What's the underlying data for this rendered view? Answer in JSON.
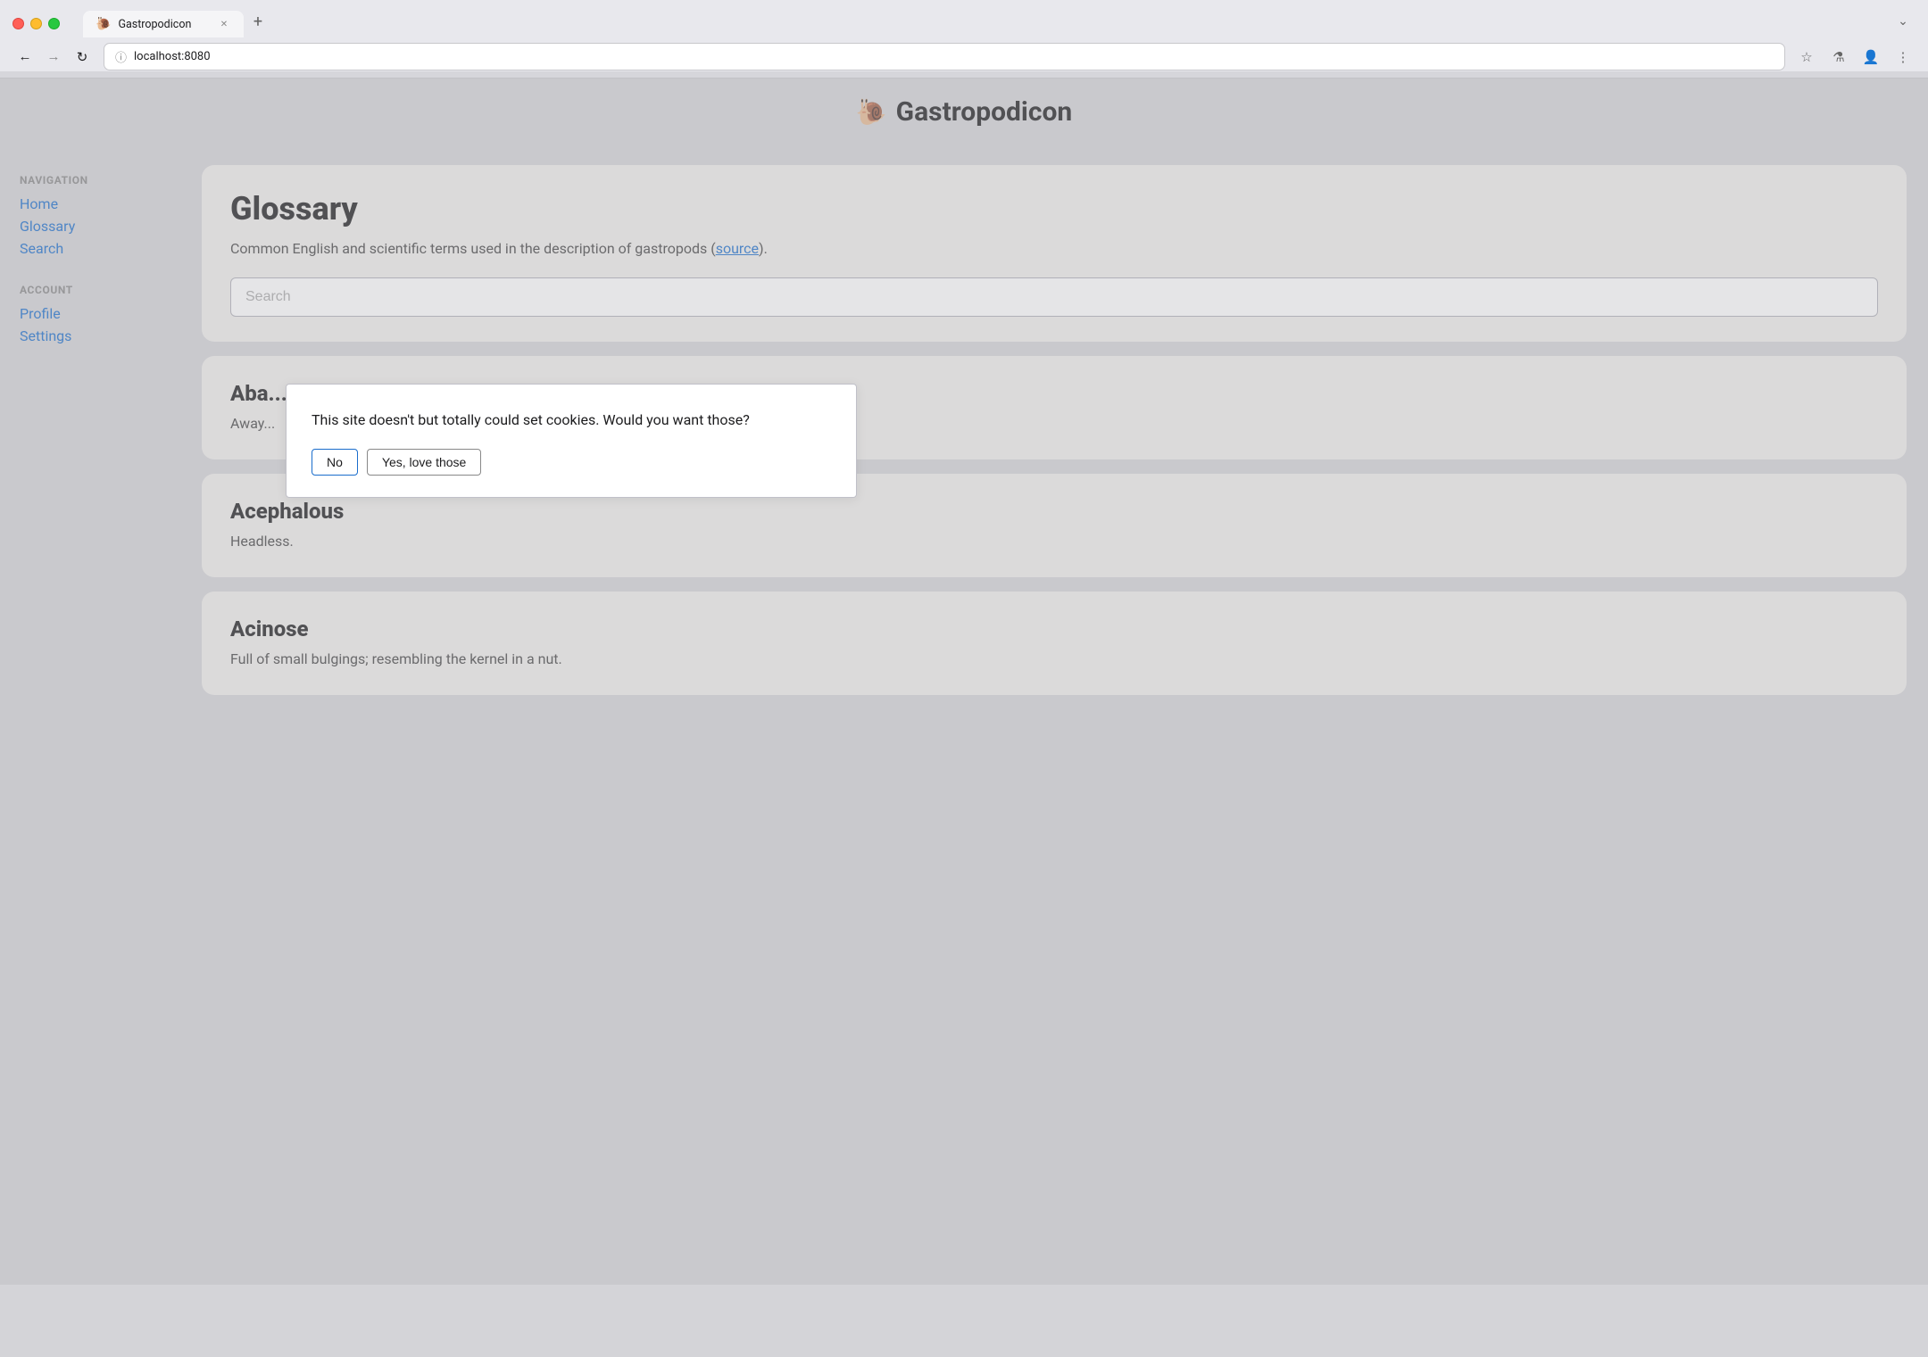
{
  "browser": {
    "tab_favicon": "🐌",
    "tab_title": "Gastropodicon",
    "tab_close": "✕",
    "tab_new": "+",
    "tab_dropdown": "⌄",
    "nav_back": "←",
    "nav_forward": "→",
    "nav_refresh": "↻",
    "address_icon": "ⓘ",
    "address_url": "localhost:8080",
    "toolbar_bookmark": "☆",
    "toolbar_labs": "⚗",
    "toolbar_profile": "👤",
    "toolbar_menu": "⋮"
  },
  "app": {
    "icon": "🐌",
    "title": "Gastropodicon"
  },
  "sidebar": {
    "nav_label": "NAVIGATION",
    "nav_items": [
      {
        "label": "Home",
        "href": "#"
      },
      {
        "label": "Glossary",
        "href": "#"
      },
      {
        "label": "Search",
        "href": "#"
      }
    ],
    "account_label": "ACCOUNT",
    "account_items": [
      {
        "label": "Profile",
        "href": "#"
      },
      {
        "label": "Settings",
        "href": "#"
      }
    ]
  },
  "glossary": {
    "title": "Glossary",
    "description_text": "Common English and scientific terms used in the description of gastropods (",
    "description_link_text": "source",
    "description_end": ").",
    "search_placeholder": "Search"
  },
  "terms": [
    {
      "title": "Aba...",
      "definition": "Away..."
    },
    {
      "title": "Acephalous",
      "definition": "Headless."
    },
    {
      "title": "Acinose",
      "definition": "Full of small bulgings; resembling the kernel in a nut."
    }
  ],
  "cookie_dialog": {
    "message": "This site doesn't but totally could set cookies. Would you want those?",
    "btn_no": "No",
    "btn_yes": "Yes, love those"
  }
}
